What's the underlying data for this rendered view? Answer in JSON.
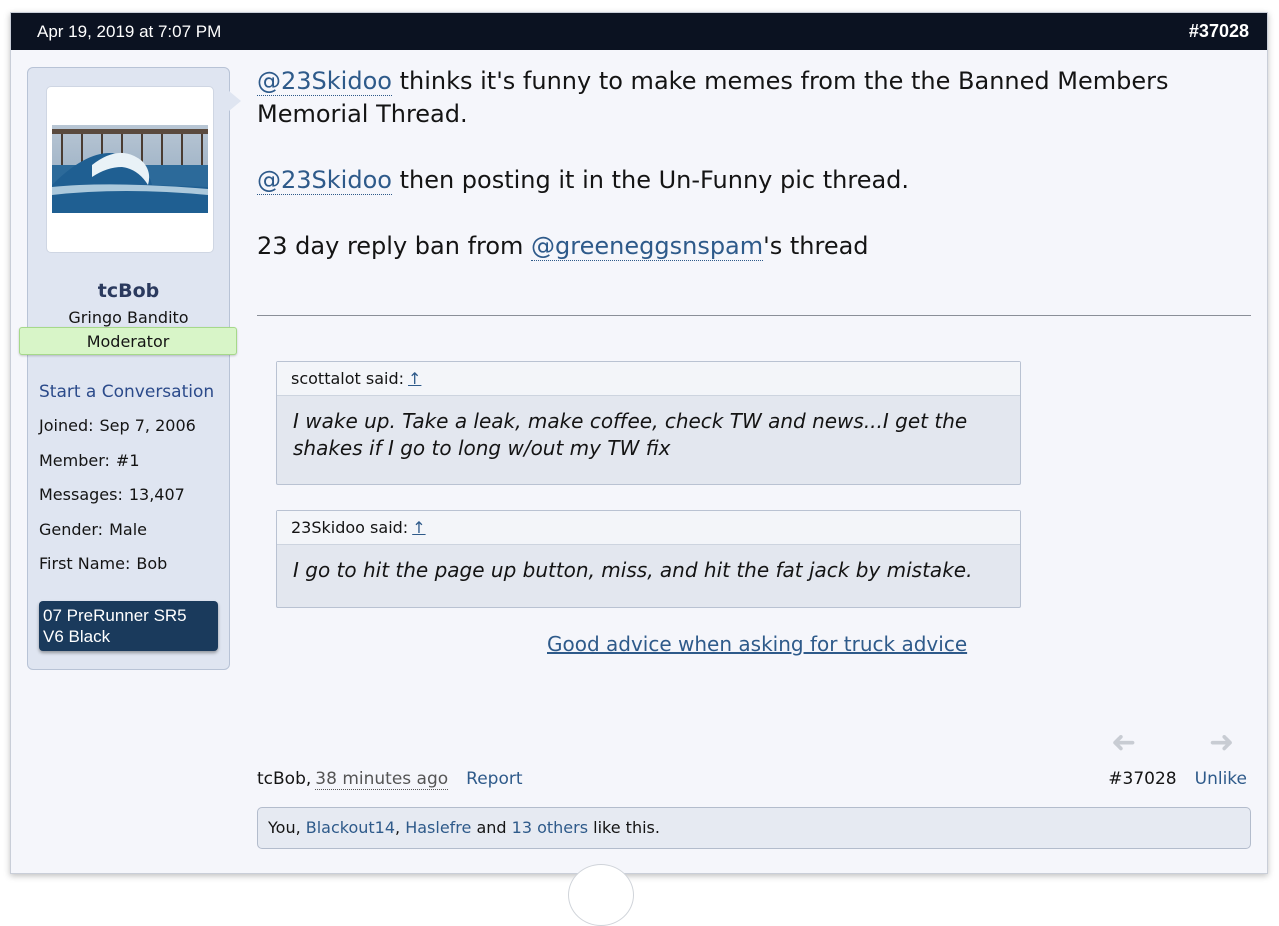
{
  "header": {
    "date": "Apr 19, 2019 at 7:07 PM",
    "post_number": "#37028"
  },
  "user": {
    "name": "tcBob",
    "title": "Gringo Bandito",
    "banner": "Moderator",
    "start_conversation": "Start a Conversation",
    "stats": [
      {
        "label": "Joined:",
        "value": "Sep 7, 2006"
      },
      {
        "label": "Member:",
        "value": "#1"
      },
      {
        "label": "Messages:",
        "value": "13,407"
      },
      {
        "label": "Gender:",
        "value": "Male"
      },
      {
        "label": "First Name:",
        "value": "Bob"
      }
    ],
    "truck_line1": "07 PreRunner SR5",
    "truck_line2": "V6 Black"
  },
  "message": {
    "p1_mention": "@23Skidoo",
    "p1_text": " thinks it's funny to make memes from the the Banned Members Memorial Thread.",
    "p2_mention": "@23Skidoo",
    "p2_text": " then posting it in the Un-Funny pic thread.",
    "p3_pre": "23 day reply ban from ",
    "p3_mention": "@greeneggsnspam",
    "p3_post": "'s thread"
  },
  "quotes": [
    {
      "author": "scottalot said:",
      "up": "↑",
      "text": "I wake up. Take a leak, make coffee, check TW and news...I get the shakes if I go to long w/out my TW fix"
    },
    {
      "author": "23Skidoo said:",
      "up": "↑",
      "text": "I go to hit the page up button, miss, and hit the fat jack by mistake."
    }
  ],
  "signature": "Good advice when asking for truck advice",
  "footer": {
    "author": "tcBob,",
    "time": "38 minutes ago",
    "report": "Report",
    "post_number": "#37028",
    "unlike": "Unlike"
  },
  "likes": {
    "you": "You, ",
    "user1": "Blackout14",
    "sep1": ", ",
    "user2": "Haslefre",
    "and": " and ",
    "others": "13 others",
    "tail": " like this."
  },
  "icons": {
    "prev": "arrow-left-icon",
    "next": "arrow-right-icon"
  }
}
